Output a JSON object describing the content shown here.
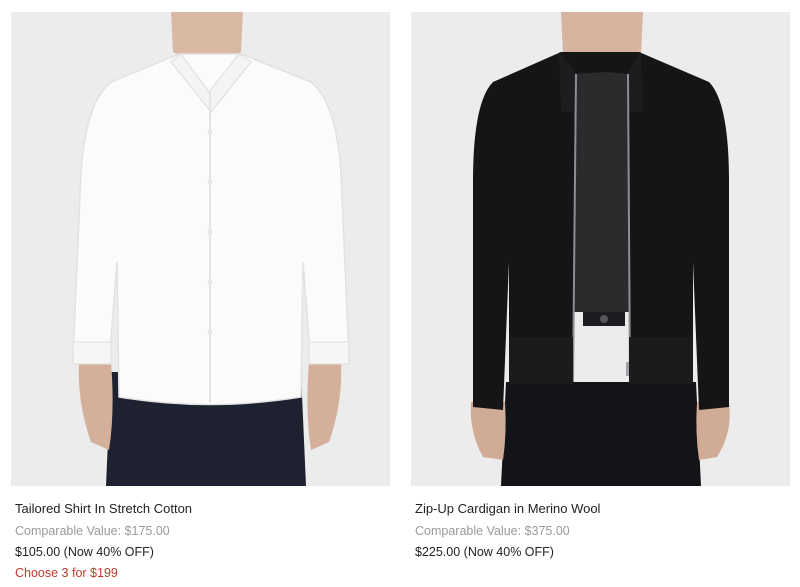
{
  "products": [
    {
      "name": "Tailored Shirt In Stretch Cotton",
      "comparable": "Comparable Value: $175.00",
      "price": "$105.00 (Now 40% OFF)",
      "promo": "Choose 3 for $199",
      "image_icon": "white-shirt-photo"
    },
    {
      "name": "Zip-Up Cardigan in Merino Wool",
      "comparable": "Comparable Value: $375.00",
      "price": "$225.00 (Now 40% OFF)",
      "promo": "",
      "image_icon": "black-cardigan-photo"
    }
  ],
  "colors": {
    "photo_bg": "#ececec",
    "comparable_text": "#9a9a9a",
    "promo_text": "#c0392b"
  }
}
